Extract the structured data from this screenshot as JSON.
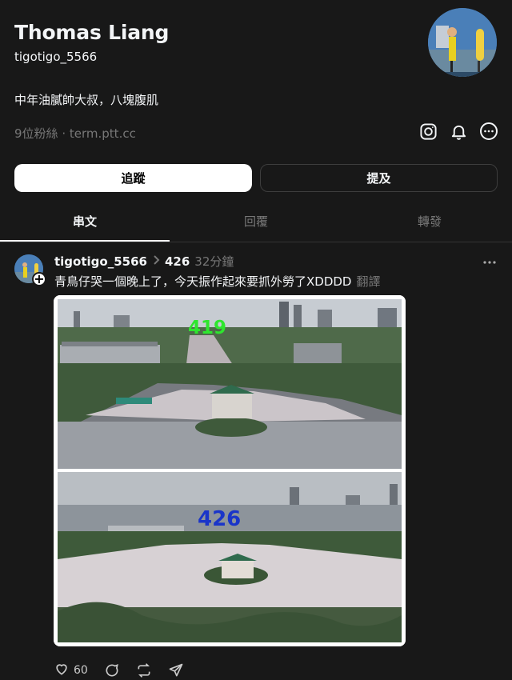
{
  "profile": {
    "name": "Thomas Liang",
    "handle": "tigotigo_5566",
    "bio": "中年油膩帥大叔，八塊腹肌",
    "followers": "9位粉絲",
    "separator": "·",
    "link": "term.ptt.cc"
  },
  "buttons": {
    "follow": "追蹤",
    "mention": "提及"
  },
  "tabs": [
    "串文",
    "回覆",
    "轉發"
  ],
  "post": {
    "user": "tigotigo_5566",
    "reply_to": "426",
    "time": "32分鐘",
    "text": "青鳥仔哭一個晚上了，今天振作起來要抓外勞了XDDDD",
    "translate": "翻譯",
    "image_labels": {
      "top": "419",
      "bottom": "426"
    },
    "likes": "60"
  },
  "icons": [
    "instagram-icon",
    "bell-icon",
    "more-circle-icon",
    "chevron-right-icon",
    "more-horizontal-icon",
    "heart-icon",
    "comment-icon",
    "repost-icon",
    "share-icon",
    "plus-icon"
  ],
  "colors": {
    "background": "#181818",
    "text": "#f3f5f7",
    "muted": "#777777",
    "button_light": "#ffffff",
    "border": "#3d3d3d"
  }
}
